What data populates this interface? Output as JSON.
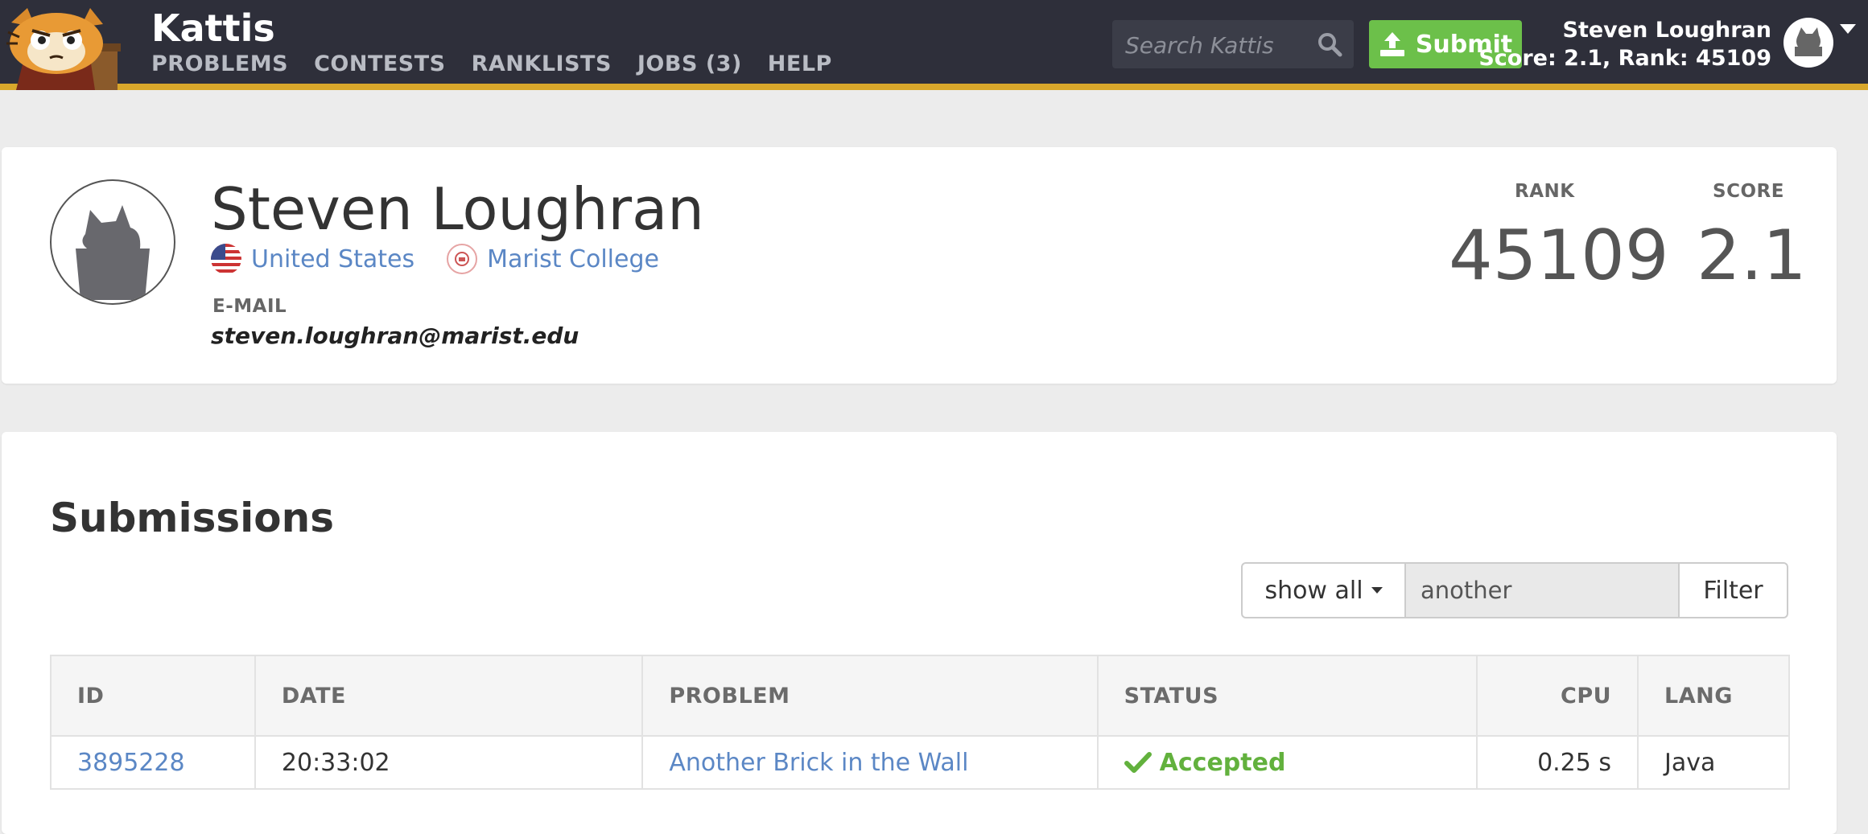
{
  "header": {
    "brand": "Kattis",
    "nav": [
      "PROBLEMS",
      "CONTESTS",
      "RANKLISTS",
      "JOBS (3)",
      "HELP"
    ],
    "search_placeholder": "Search Kattis",
    "submit_label": "Submit",
    "user_name": "Steven Loughran",
    "user_score_line": "Score: 2.1, Rank: 45109"
  },
  "profile": {
    "name": "Steven Loughran",
    "country": "United States",
    "school": "Marist College",
    "email_label": "E-MAIL",
    "email": "steven.loughran@marist.edu",
    "rank_label": "RANK",
    "rank": "45109",
    "score_label": "SCORE",
    "score": "2.1"
  },
  "submissions": {
    "title": "Submissions",
    "filter_dropdown": "show all",
    "filter_value": "another",
    "filter_button": "Filter",
    "columns": [
      "ID",
      "DATE",
      "PROBLEM",
      "STATUS",
      "CPU",
      "LANG"
    ],
    "rows": [
      {
        "id": "3895228",
        "date": "20:33:02",
        "problem": "Another Brick in the Wall",
        "status": "Accepted",
        "cpu": "0.25 s",
        "lang": "Java"
      }
    ]
  },
  "colors": {
    "topbar": "#2e2f3a",
    "accent_stripe": "#d9a72b",
    "submit_green": "#6cc04a",
    "link_blue": "#5b87c5",
    "accepted_green": "#62b13d"
  }
}
